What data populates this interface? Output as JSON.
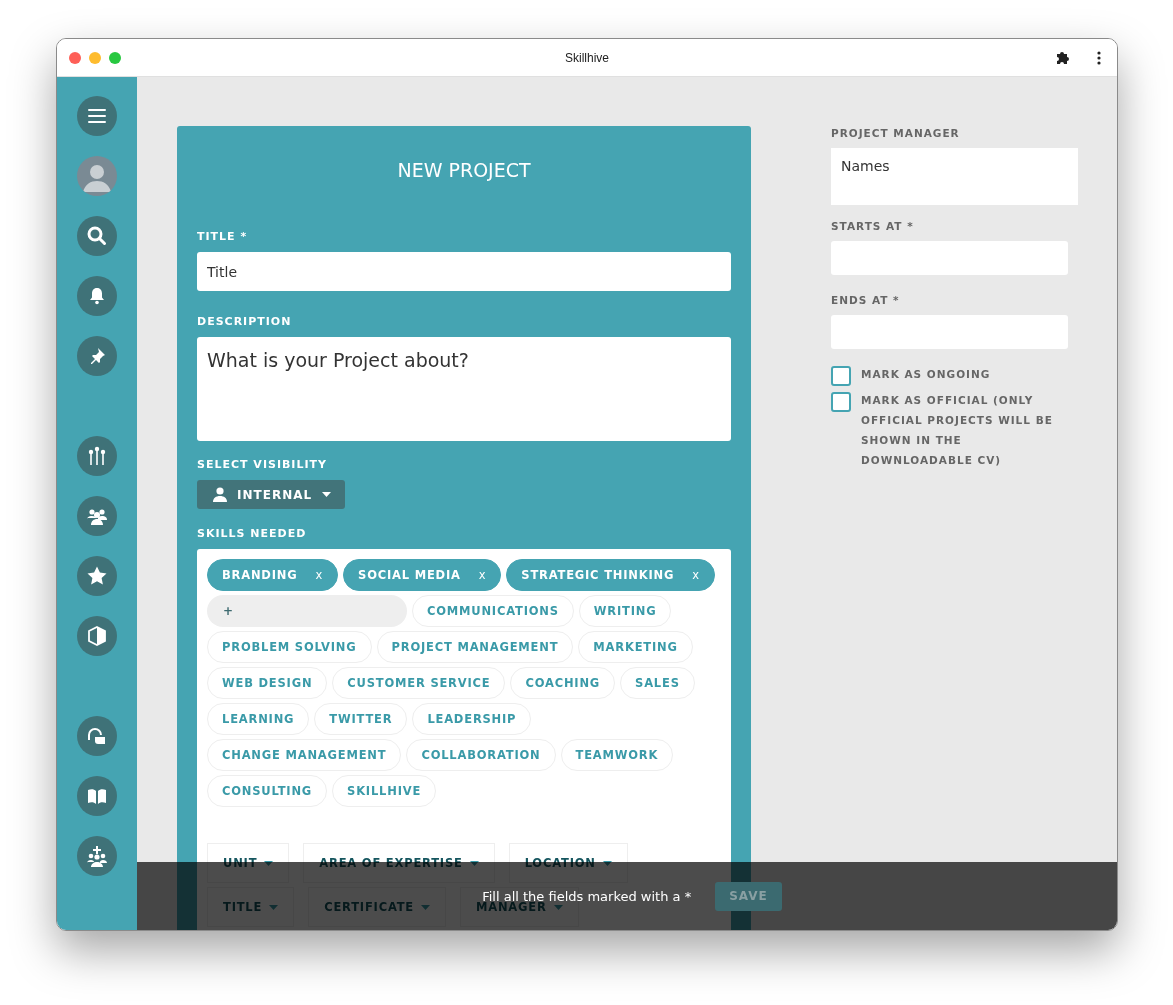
{
  "window": {
    "title": "Skillhive"
  },
  "form": {
    "title": "NEW PROJECT",
    "fields": [
      {
        "kind": "text",
        "label": "TITLE *",
        "placeholder": "Title"
      },
      {
        "kind": "textarea",
        "label": "DESCRIPTION",
        "placeholder": "What is your Project about?"
      }
    ],
    "visibility": {
      "label": "SELECT VISIBILITY",
      "value": "INTERNAL"
    },
    "skills": {
      "label": "SKILLS NEEDED",
      "chosen": [
        {
          "label": "BRANDING",
          "remove": "x"
        },
        {
          "label": "SOCIAL MEDIA",
          "remove": "x"
        },
        {
          "label": "STRATEGIC THINKING",
          "remove": "x"
        }
      ],
      "add_label": "+",
      "suggestions": [
        "COMMUNICATIONS",
        "WRITING",
        "PROBLEM SOLVING",
        "PROJECT MANAGEMENT",
        "MARKETING",
        "WEB DESIGN",
        "CUSTOMER SERVICE",
        "COACHING",
        "SALES",
        "LEARNING",
        "TWITTER",
        "LEADERSHIP",
        "CHANGE MANAGEMENT",
        "COLLABORATION",
        "TEAMWORK",
        "CONSULTING",
        "SKILLHIVE"
      ],
      "filters": [
        "UNIT",
        "AREA OF EXPERTISE",
        "LOCATION",
        "TITLE",
        "CERTIFICATE",
        "MANAGER"
      ]
    }
  },
  "side": {
    "manager": {
      "label": "PROJECT MANAGER",
      "placeholder": "Names"
    },
    "dates": [
      {
        "label": "STARTS AT *"
      },
      {
        "label": "ENDS AT *"
      }
    ],
    "checkboxes": [
      {
        "label": "MARK AS ONGOING",
        "checked": false
      },
      {
        "label": "MARK AS OFFICIAL (ONLY OFFICIAL PROJECTS WILL BE SHOWN IN THE DOWNLOADABLE CV)",
        "checked": false
      }
    ]
  },
  "footer": {
    "message": "Fill all the fields marked with a *",
    "save": {
      "label": "SAVE",
      "disabled": true
    }
  }
}
